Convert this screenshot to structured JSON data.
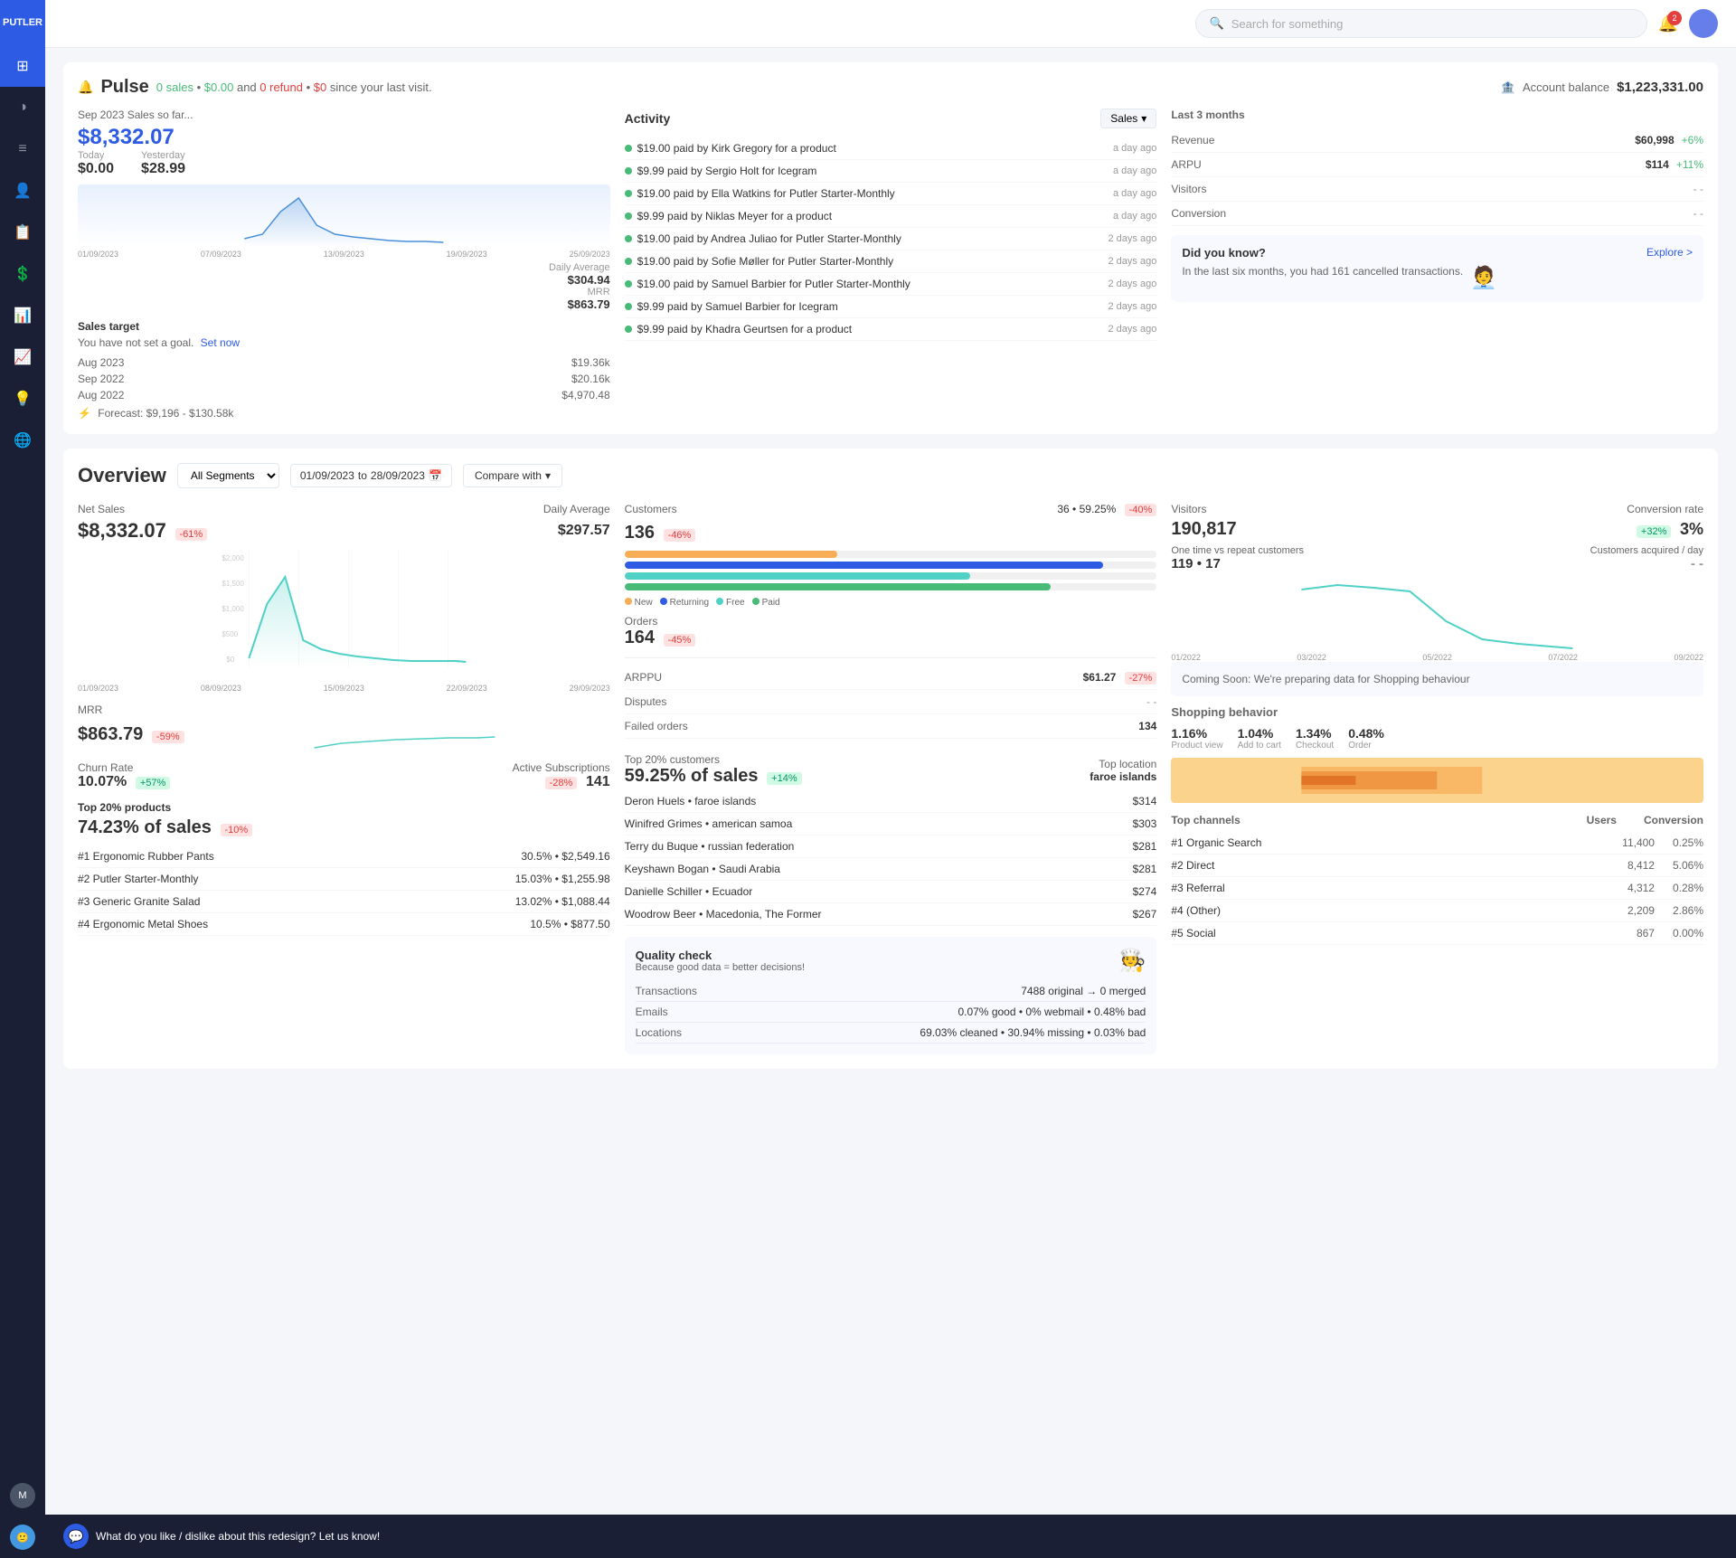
{
  "app": {
    "name": "PUTLER"
  },
  "header": {
    "search_placeholder": "Search for something",
    "notification_count": "2"
  },
  "pulse": {
    "title": "Pulse",
    "subtitle_start": "0 sales",
    "subtitle_mid": "$0.00",
    "subtitle_refund": "0 refund",
    "subtitle_refund_amt": "$0",
    "subtitle_end": "since your last visit.",
    "sep_label": "Sep 2023 Sales so far...",
    "big_amount": "$8,332.07",
    "today_label": "Today",
    "today_value": "$0.00",
    "yesterday_label": "Yesterday",
    "yesterday_value": "$28.99",
    "daily_avg_label": "Daily Average",
    "daily_avg_value": "$304.94",
    "mrr_label": "MRR",
    "mrr_value": "$863.79",
    "chart_dates": [
      "01/09/2023",
      "07/09/2023",
      "13/09/2023",
      "19/09/2023",
      "25/09/2023"
    ],
    "sales_target_label": "Sales target",
    "sales_target_sub": "You have not set a goal.",
    "set_now": "Set now",
    "target_rows": [
      {
        "period": "Aug 2023",
        "value": "$19.36k"
      },
      {
        "period": "Sep 2022",
        "value": "$20.16k"
      },
      {
        "period": "Aug 2022",
        "value": "$4,970.48"
      }
    ],
    "forecast": "Forecast: $9,196 - $130.58k",
    "account_balance_label": "Account balance",
    "account_balance_value": "$1,223,331.00",
    "last3_title": "Last 3 months",
    "metrics": [
      {
        "label": "Revenue",
        "value": "$60,998",
        "change": "+6%",
        "positive": true
      },
      {
        "label": "ARPU",
        "value": "$114",
        "change": "+11%",
        "positive": true
      },
      {
        "label": "Visitors",
        "value": "--",
        "change": "",
        "positive": false
      },
      {
        "label": "Conversion",
        "value": "--",
        "change": "",
        "positive": false
      }
    ],
    "did_you_know_title": "Did you know?",
    "explore_label": "Explore >",
    "did_you_know_text": "In the last six months, you had 161 cancelled transactions.",
    "activity_title": "Activity",
    "sales_btn": "Sales",
    "activity_items": [
      {
        "text": "$19.00 paid by Kirk Gregory for a product",
        "time": "a day ago"
      },
      {
        "text": "$9.99 paid by Sergio Holt for Icegram",
        "time": "a day ago"
      },
      {
        "text": "$19.00 paid by Ella Watkins for Putler Starter-Monthly",
        "time": "a day ago"
      },
      {
        "text": "$9.99 paid by Niklas Meyer for a product",
        "time": "a day ago"
      },
      {
        "text": "$19.00 paid by Andrea Juliao for Putler Starter-Monthly",
        "time": "2 days ago"
      },
      {
        "text": "$19.00 paid by Sofie Møller for Putler Starter-Monthly",
        "time": "2 days ago"
      },
      {
        "text": "$19.00 paid by Samuel Barbier for Putler Starter-Monthly",
        "time": "2 days ago"
      },
      {
        "text": "$9.99 paid by Samuel Barbier for Icegram",
        "time": "2 days ago"
      },
      {
        "text": "$9.99 paid by Khadra Geurtsen for a product",
        "time": "2 days ago"
      }
    ]
  },
  "overview": {
    "title": "Overview",
    "segment_label": "All Segments",
    "date_from": "01/09/2023",
    "date_to": "28/09/2023",
    "compare_label": "Compare with",
    "net_sales_label": "Net Sales",
    "net_sales_value": "$8,332.07",
    "net_sales_change": "-61%",
    "daily_avg_label": "Daily Average",
    "daily_avg_value": "$297.57",
    "chart_x": [
      "01/09/2023",
      "08/09/2023",
      "15/09/2023",
      "22/09/2023",
      "29/09/2023"
    ],
    "customers_label": "Customers",
    "customers_value": "136",
    "customers_change": "-46%",
    "customers_right": "36 • 59.25%",
    "customers_right_change": "-40%",
    "orders_label": "Orders",
    "orders_value": "164",
    "orders_change": "-45%",
    "bar_legend": [
      "New",
      "Returning",
      "Free",
      "Paid"
    ],
    "arppu_label": "ARPPU",
    "arppu_value": "$61.27",
    "arppu_change": "-27%",
    "disputes_label": "Disputes",
    "disputes_value": "- -",
    "failed_label": "Failed orders",
    "failed_value": "134",
    "visitors_label": "Visitors",
    "visitors_value": "190,817",
    "conversion_label": "Conversion rate",
    "conversion_change": "+32%",
    "conversion_value": "3%",
    "one_time_label": "One time vs repeat customers",
    "one_time_value": "119 • 17",
    "acquired_label": "Customers acquired / day",
    "acquired_value": "- -",
    "mrr_label": "MRR",
    "mrr_value": "$863.79",
    "mrr_change": "-59%",
    "churn_label": "Churn Rate",
    "churn_value": "10.07%",
    "churn_change": "+57%",
    "active_subs_label": "Active Subscriptions",
    "active_subs_change": "-28%",
    "active_subs_value": "141",
    "top_products_label": "Top 20% products",
    "top_products_pct": "74.23% of sales",
    "top_products_change": "-10%",
    "products": [
      {
        "rank": "#1 Ergonomic Rubber Pants",
        "pct": "30.5%",
        "value": "$2,549.16"
      },
      {
        "rank": "#2 Putler Starter-Monthly",
        "pct": "15.03%",
        "value": "$1,255.98"
      },
      {
        "rank": "#3 Generic Granite Salad",
        "pct": "13.02%",
        "value": "$1,088.44"
      },
      {
        "rank": "#4 Ergonomic Metal Shoes",
        "pct": "10.5%",
        "value": "$877.50"
      }
    ],
    "top_cust_label": "Top 20% customers",
    "top_cust_pct": "59.25% of sales",
    "top_cust_change": "+14%",
    "top_location_label": "Top location",
    "top_location_value": "faroe islands",
    "customers_list": [
      {
        "name": "Deron Huels • faroe islands",
        "value": "$314"
      },
      {
        "name": "Winifred Grimes • american samoa",
        "value": "$303"
      },
      {
        "name": "Terry du Buque • russian federation",
        "value": "$281"
      },
      {
        "name": "Keyshawn Bogan • Saudi Arabia",
        "value": "$281"
      },
      {
        "name": "Danielle Schiller • Ecuador",
        "value": "$274"
      },
      {
        "name": "Woodrow Beer • Macedonia, The Former",
        "value": "$267"
      }
    ],
    "quality_title": "Quality check",
    "quality_sub": "Because good data = better decisions!",
    "qc_items": [
      {
        "label": "Transactions",
        "value": "7488 original → 0 merged"
      },
      {
        "label": "Emails",
        "value": "0.07% good • 0% webmail • 0.48% bad"
      },
      {
        "label": "Locations",
        "value": "69.03% cleaned • 30.94% missing • 0.03% bad"
      }
    ],
    "coming_soon_text": "Coming Soon: We're preparing data for Shopping behaviour",
    "shopping_title": "Shopping behavior",
    "shopping_steps": [
      {
        "pct": "1.16%",
        "label": "Product view"
      },
      {
        "pct": "1.04%",
        "label": "Add to cart"
      },
      {
        "pct": "1.34%",
        "label": "Checkout"
      },
      {
        "pct": "0.48%",
        "label": "Order"
      }
    ],
    "channels_title": "Top channels",
    "channels_users_label": "Users",
    "channels_conv_label": "Conversion",
    "channels": [
      {
        "name": "#1 Organic Search",
        "users": "11,400",
        "conversion": "0.25%"
      },
      {
        "name": "#2 Direct",
        "users": "8,412",
        "conversion": "5.06%"
      },
      {
        "name": "#3 Referral",
        "users": "4,312",
        "conversion": "0.28%"
      },
      {
        "name": "#4 (Other)",
        "users": "2,209",
        "conversion": "2.86%"
      },
      {
        "name": "#5 Social",
        "users": "867",
        "conversion": "0.00%"
      }
    ],
    "vis_chart_x": [
      "01/2022",
      "03/2022",
      "05/2022",
      "07/2022",
      "09/2022"
    ]
  },
  "feedback": {
    "text": "What do you like / dislike about this redesign? Let us know!"
  },
  "sidebar": {
    "items": [
      {
        "icon": "⊞",
        "name": "dashboard",
        "active": true
      },
      {
        "icon": "◑",
        "name": "analytics"
      },
      {
        "icon": "≡",
        "name": "reports"
      },
      {
        "icon": "👤",
        "name": "customers"
      },
      {
        "icon": "📋",
        "name": "orders"
      },
      {
        "icon": "💲",
        "name": "revenue"
      },
      {
        "icon": "📊",
        "name": "charts"
      },
      {
        "icon": "📈",
        "name": "trends"
      },
      {
        "icon": "💡",
        "name": "insights"
      },
      {
        "icon": "🌐",
        "name": "global"
      }
    ]
  }
}
